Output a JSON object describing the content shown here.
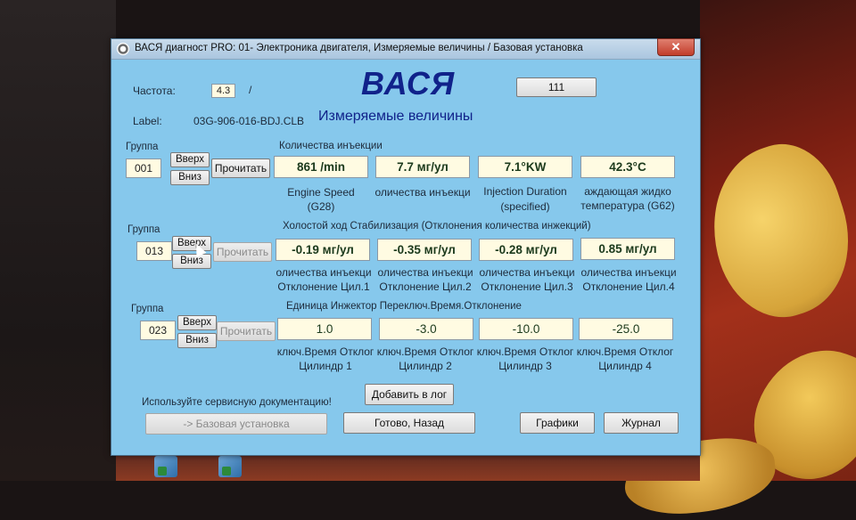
{
  "window": {
    "title": "ВАСЯ диагност PRO: 01- Электроника двигателя,  Измеряемые величины / Базовая установка",
    "close_glyph": "✕"
  },
  "header": {
    "freq_label": "Частота:",
    "freq_value": "4.3",
    "freq_unit": "/",
    "logo": "ВАСЯ",
    "counter": "111",
    "label_caption": "Label:",
    "label_value": "03G-906-016-BDJ.CLB",
    "section_title": "Измеряемые величины"
  },
  "buttons": {
    "up": "Вверх",
    "down": "Вниз",
    "read": "Прочитать",
    "add_log": "Добавить в лог",
    "basic_setting": "-> Базовая установка",
    "done_back": "Готово, Назад",
    "graphs": "Графики",
    "journal": "Журнал"
  },
  "groups": [
    {
      "label": "Группа",
      "number": "001",
      "heading": "Количества инъекции",
      "values": [
        "861 /min",
        "7.7 мг/ул",
        "7.1°KW",
        "42.3°C"
      ],
      "desc1": [
        "Engine Speed",
        "оличества инъекци",
        "Injection Duration",
        "аждающая жидко"
      ],
      "desc2": [
        "(G28)",
        "",
        "(specified)",
        "температура (G62)"
      ]
    },
    {
      "label": "Группа",
      "number": "013",
      "heading": "Холостой ход Стабилизация (Отклонения количества инжекций)",
      "values": [
        "-0.19 мг/ул",
        "-0.35 мг/ул",
        "-0.28 мг/ул",
        "0.85 мг/ул"
      ],
      "desc1": [
        "оличества инъекци",
        "оличества инъекци",
        "оличества инъекци",
        "оличества инъекци"
      ],
      "desc2": [
        "Отклонение Цил.1",
        "Отклонение Цил.2",
        "Отклонение Цил.3",
        "Отклонение Цил.4"
      ]
    },
    {
      "label": "Группа",
      "number": "023",
      "heading": "Единица Инжектор Переключ.Время.Отклонение",
      "values": [
        "1.0",
        "-3.0",
        "-10.0",
        "-25.0"
      ],
      "desc1": [
        "ключ.Время Отклог",
        "ключ.Время Отклог",
        "ключ.Время Отклог",
        "ключ.Время Отклог"
      ],
      "desc2": [
        "Цилиндр 1",
        "Цилиндр 2",
        "Цилиндр 3",
        "Цилиндр 4"
      ]
    }
  ],
  "footer": {
    "hint": "Используйте сервисную документацию!"
  },
  "colors": {
    "window_bg": "#86c8ec",
    "logo": "#10228a",
    "value_box": "#fffbe2"
  }
}
